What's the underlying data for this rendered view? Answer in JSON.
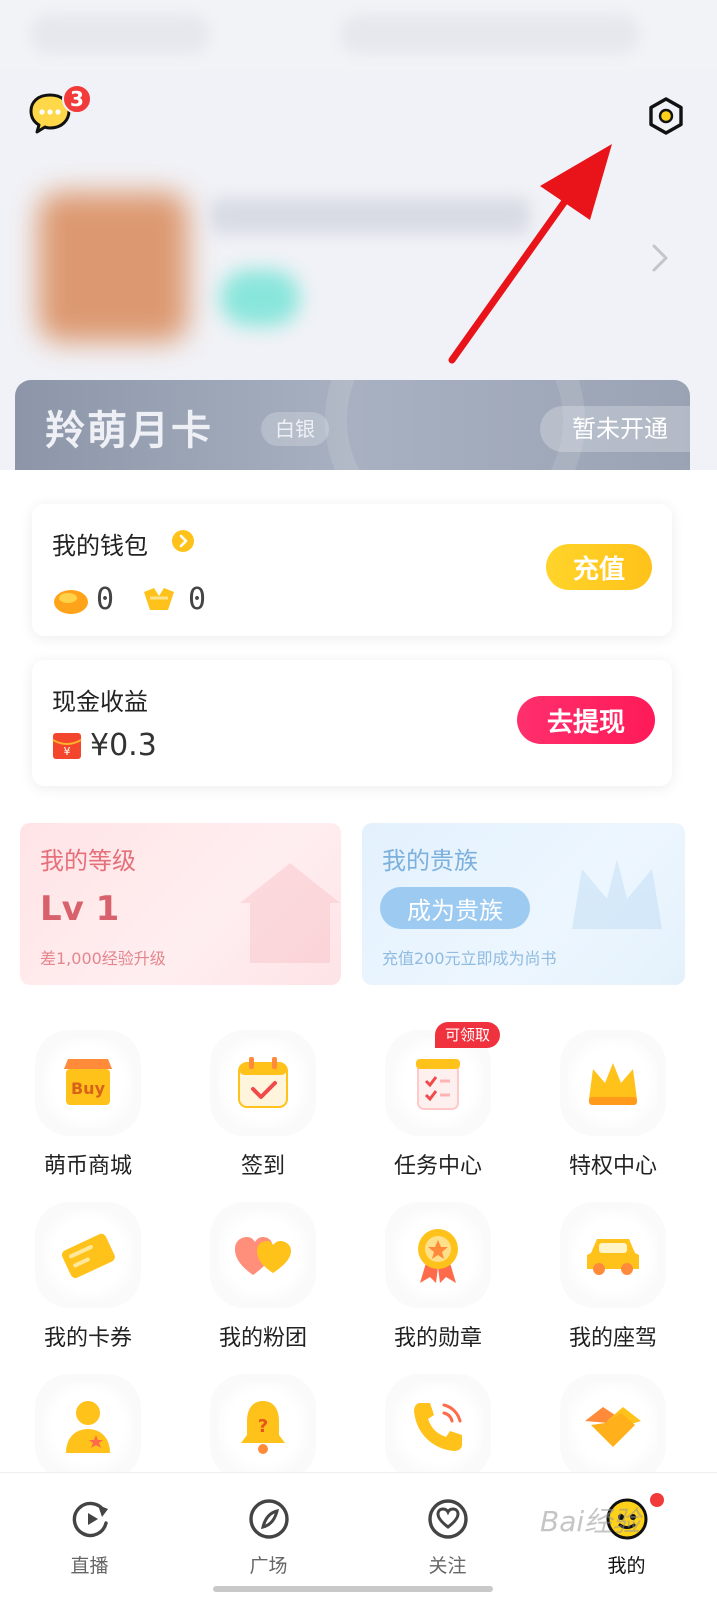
{
  "header": {
    "message_badge": "3"
  },
  "vip_card": {
    "title": "羚萌月卡",
    "tier": "白银",
    "status": "暂未开通"
  },
  "wallet": {
    "title": "我的钱包",
    "coin_value": "0",
    "gold_value": "0",
    "recharge_label": "充值"
  },
  "cash": {
    "title": "现金收益",
    "value": "¥0.3",
    "withdraw_label": "去提现"
  },
  "level": {
    "title": "我的等级",
    "value": "Lv 1",
    "sub": "差1,000经验升级"
  },
  "noble": {
    "title": "我的贵族",
    "button": "成为贵族",
    "sub": "充值200元立即成为尚书"
  },
  "grid": {
    "items": [
      {
        "label": "萌币商城",
        "icon": "shop-buy-icon"
      },
      {
        "label": "签到",
        "icon": "calendar-check-icon"
      },
      {
        "label": "任务中心",
        "icon": "task-list-icon",
        "badge": "可领取"
      },
      {
        "label": "特权中心",
        "icon": "crown-icon"
      },
      {
        "label": "我的卡券",
        "icon": "ticket-icon"
      },
      {
        "label": "我的粉团",
        "icon": "hearts-icon"
      },
      {
        "label": "我的勋章",
        "icon": "medal-icon"
      },
      {
        "label": "我的座驾",
        "icon": "car-icon"
      },
      {
        "label": "",
        "icon": "user-star-icon"
      },
      {
        "label": "",
        "icon": "bell-question-icon"
      },
      {
        "label": "",
        "icon": "phone-icon"
      },
      {
        "label": "",
        "icon": "handshake-icon"
      }
    ]
  },
  "tabbar": {
    "tabs": [
      {
        "label": "直播",
        "icon": "replay-icon"
      },
      {
        "label": "广场",
        "icon": "compass-icon"
      },
      {
        "label": "关注",
        "icon": "heart-circle-icon"
      },
      {
        "label": "我的",
        "icon": "avatar-face-icon"
      }
    ]
  },
  "watermark": "Bai经验",
  "colors": {
    "accent_yellow": "#ffc21a",
    "accent_pink": "#ff1a58",
    "badge_red": "#f23a3a",
    "annotation_red": "#e8141a"
  }
}
